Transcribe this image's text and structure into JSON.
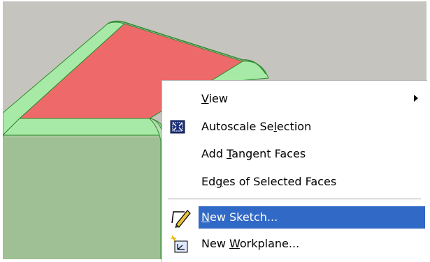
{
  "viewport": {
    "colors": {
      "background": "#c6c4be",
      "selected_face": "#ee6a6a",
      "body": "#a6c59a",
      "fillet": "#a7eaa7",
      "edge": "#2e8b2e"
    }
  },
  "context_menu": {
    "highlight_color": "#3169c6",
    "items": [
      {
        "pre": "",
        "ul": "V",
        "post": "iew",
        "icon": "",
        "has_submenu": true
      },
      {
        "pre": "Autoscale Se",
        "ul": "l",
        "post": "ection",
        "icon": "autoscale-icon",
        "has_submenu": false
      },
      {
        "pre": "Add ",
        "ul": "T",
        "post": "angent Faces",
        "icon": "",
        "has_submenu": false
      },
      {
        "pre": "Ed",
        "ul": "g",
        "post": "es of Selected Faces",
        "icon": "",
        "has_submenu": false
      },
      {
        "pre": "",
        "ul": "N",
        "post": "ew Sketch...",
        "icon": "new-sketch-icon",
        "has_submenu": false,
        "highlighted": true
      },
      {
        "pre": "New ",
        "ul": "W",
        "post": "orkplane...",
        "icon": "new-workplane-icon",
        "has_submenu": false
      }
    ]
  }
}
